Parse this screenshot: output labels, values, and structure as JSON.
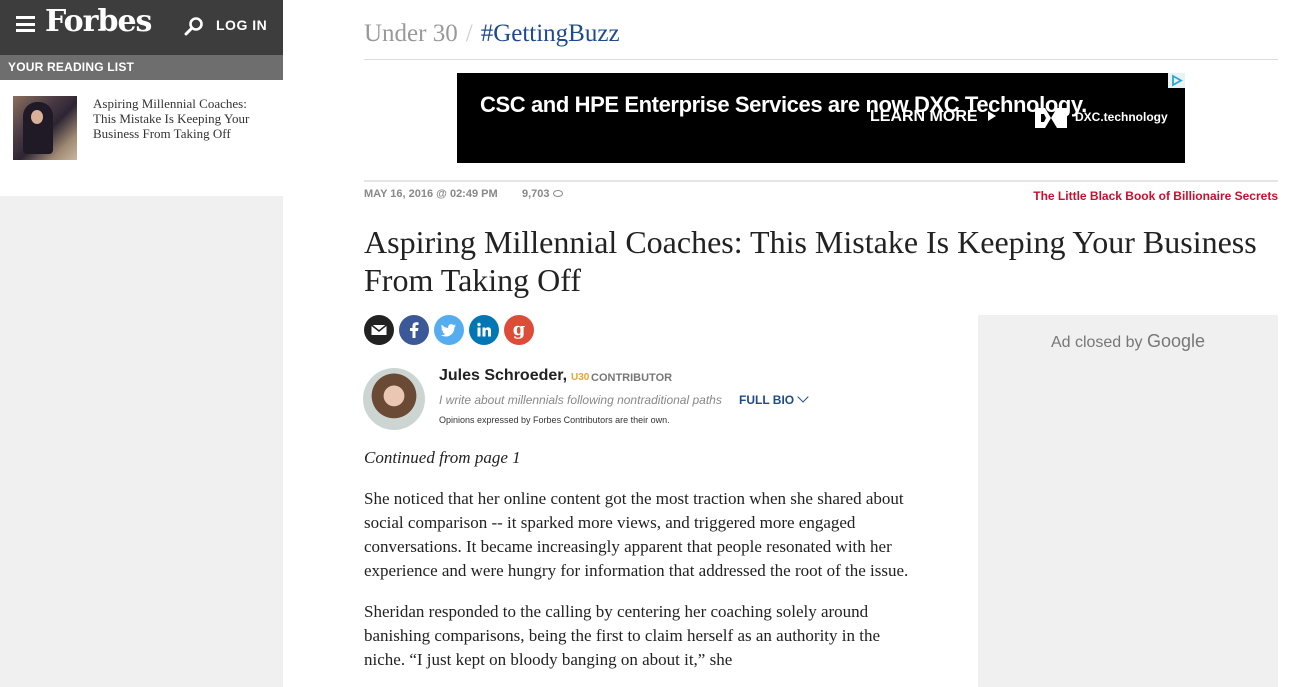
{
  "sidebar": {
    "logo": "Forbes",
    "login_label": "LOG IN",
    "reading_list_label": "YOUR READING LIST",
    "reading_list_items": [
      {
        "title": "Aspiring Millennial Coaches: This Mistake Is Keeping Your Business From Taking Off"
      }
    ]
  },
  "breadcrumb": {
    "section": "Under 30",
    "separator": "/",
    "topic": "#GettingBuzz"
  },
  "ad_banner": {
    "headline": "CSC and HPE Enterprise Services are now DXC Technology.",
    "cta": "LEARN MORE",
    "brand": "DXC.technology"
  },
  "article": {
    "date": "MAY 16, 2016 @ 02:49 PM",
    "views": "9,703",
    "promo_link": "The Little Black Book of Billionaire Secrets",
    "headline": "Aspiring Millennial Coaches: This Mistake Is Keeping Your Business From Taking Off",
    "share_buttons": [
      "email",
      "facebook",
      "twitter",
      "linkedin",
      "google-plus"
    ],
    "author": {
      "name": "Jules Schroeder,",
      "badge": "U30",
      "role": "CONTRIBUTOR",
      "tagline": "I write about millennials following nontraditional paths",
      "full_bio_label": "FULL BIO",
      "disclaimer": "Opinions expressed by Forbes Contributors are their own."
    },
    "continued": "Continued from page 1",
    "paragraphs": [
      "She noticed that her online content got the most traction when she shared about social comparison -- it sparked more views, and triggered more engaged conversations. It became increasingly apparent that people resonated with her experience and were hungry for information that addressed the root of the issue.",
      "Sheridan responded to the calling by centering her coaching solely around banishing comparisons, being the first to claim herself as an authority in the niche. “I just kept on bloody banging on about it,” she"
    ]
  },
  "side_ad": {
    "text": "Ad closed by",
    "google": "Google"
  },
  "colors": {
    "topbar": "#3d3d3d",
    "link_blue": "#1f4a8c",
    "promo_red": "#c8102e",
    "u30_gold": "#e6a532"
  }
}
